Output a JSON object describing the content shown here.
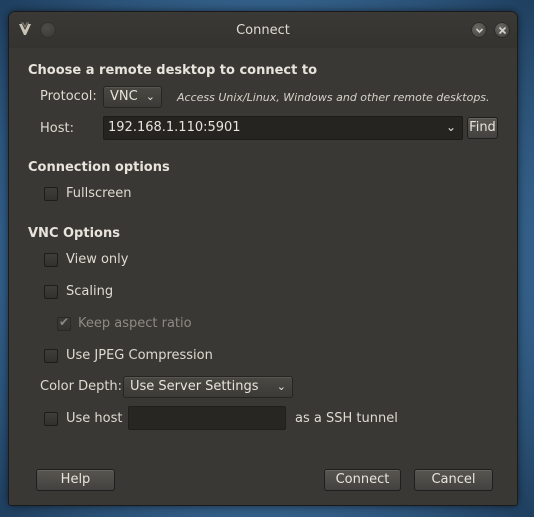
{
  "window": {
    "title": "Connect"
  },
  "remote_section": {
    "title": "Choose a remote desktop to connect to",
    "protocol_label": "Protocol:",
    "protocol_value": "VNC",
    "protocol_hint": "Access Unix/Linux, Windows and other remote desktops.",
    "host_label": "Host:",
    "host_value": "192.168.1.110:5901",
    "find_label": "Find"
  },
  "connection_options": {
    "title": "Connection options",
    "fullscreen": {
      "label": "Fullscreen",
      "checked": false
    }
  },
  "vnc_options": {
    "title": "VNC Options",
    "view_only": {
      "label": "View only",
      "checked": false
    },
    "scaling": {
      "label": "Scaling",
      "checked": false
    },
    "keep_aspect": {
      "label": "Keep aspect ratio",
      "checked": true,
      "enabled": false
    },
    "jpeg": {
      "label": "Use JPEG Compression",
      "checked": false
    },
    "color_depth_label": "Color Depth:",
    "color_depth_value": "Use Server Settings",
    "ssh_prefix": "Use host",
    "ssh_host_value": "",
    "ssh_suffix": "as a SSH tunnel"
  },
  "buttons": {
    "help": "Help",
    "connect": "Connect",
    "cancel": "Cancel"
  },
  "icons": {
    "app": "remote-desktop-icon",
    "minimize": "minimize-icon",
    "close": "close-icon"
  }
}
